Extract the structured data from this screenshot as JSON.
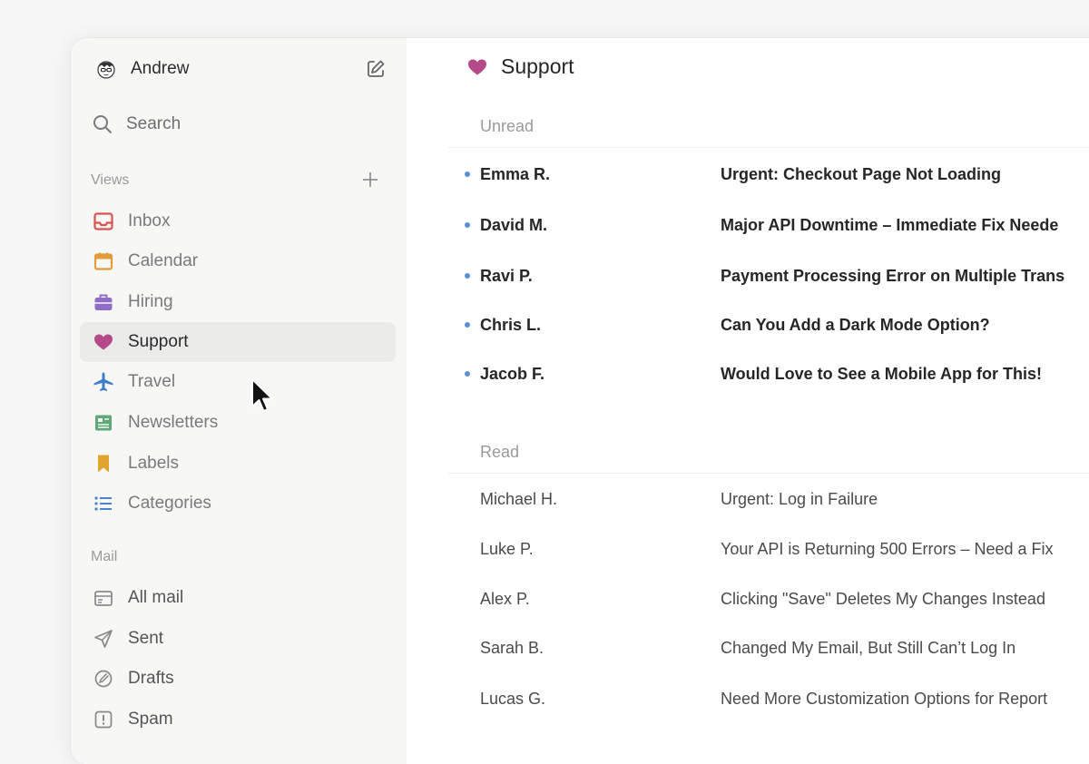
{
  "user": {
    "name": "Andrew"
  },
  "search": {
    "label": "Search"
  },
  "sidebar": {
    "views_heading": "Views",
    "mail_heading": "Mail",
    "views": [
      {
        "label": "Inbox",
        "icon": "inbox-icon",
        "color": "#d9534f"
      },
      {
        "label": "Calendar",
        "icon": "calendar-icon",
        "color": "#e39b3b"
      },
      {
        "label": "Hiring",
        "icon": "briefcase-icon",
        "color": "#8e6cc8"
      },
      {
        "label": "Support",
        "icon": "heart-icon",
        "color": "#b44a87",
        "active": true
      },
      {
        "label": "Travel",
        "icon": "airplane-icon",
        "color": "#3f7fc8"
      },
      {
        "label": "Newsletters",
        "icon": "newspaper-icon",
        "color": "#5fa87a"
      },
      {
        "label": "Labels",
        "icon": "bookmark-icon",
        "color": "#e0a52e"
      },
      {
        "label": "Categories",
        "icon": "list-icon",
        "color": "#4a86cf"
      }
    ],
    "mail": [
      {
        "label": "All mail",
        "icon": "all-mail-icon"
      },
      {
        "label": "Sent",
        "icon": "send-icon"
      },
      {
        "label": "Drafts",
        "icon": "drafts-icon"
      },
      {
        "label": "Spam",
        "icon": "spam-icon"
      }
    ]
  },
  "main": {
    "title": "Support",
    "unread_heading": "Unread",
    "read_heading": "Read",
    "unread": [
      {
        "from": "Emma R.",
        "subject": "Urgent: Checkout Page Not Loading"
      },
      {
        "from": "David M.",
        "subject": "Major API Downtime – Immediate Fix Neede"
      },
      {
        "from": "Ravi P.",
        "subject": "Payment Processing Error on Multiple Trans"
      },
      {
        "from": "Chris L.",
        "subject": "Can You Add a Dark Mode Option?"
      },
      {
        "from": "Jacob F.",
        "subject": "Would Love to See a Mobile App for This!"
      }
    ],
    "read": [
      {
        "from": "Michael H.",
        "subject": "Urgent: Log in Failure"
      },
      {
        "from": "Luke P.",
        "subject": "Your API is Returning 500 Errors – Need a Fix"
      },
      {
        "from": "Alex P.",
        "subject": "Clicking \"Save\" Deletes My Changes Instead"
      },
      {
        "from": "Sarah B.",
        "subject": "Changed My Email, But Still Can’t Log In"
      },
      {
        "from": "Lucas G.",
        "subject": "Need More Customization Options for Report"
      }
    ]
  },
  "colors": {
    "accent_dot": "#5b8fd4",
    "active_bg": "#ebebea"
  }
}
